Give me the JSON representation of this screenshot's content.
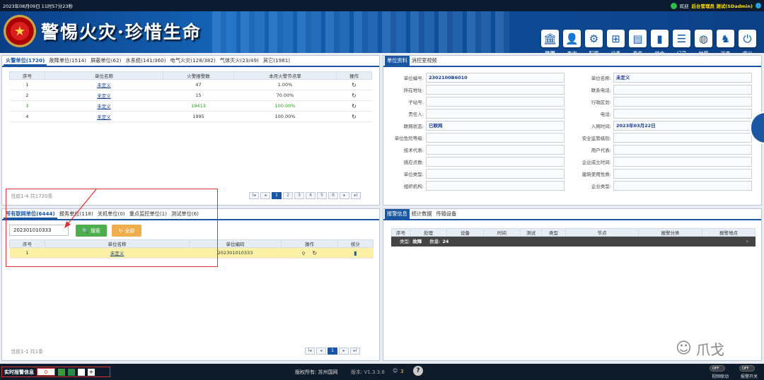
{
  "topbar": {
    "datetime": "2023年08月09日 11时57分23秒",
    "welcome": "欢迎",
    "user": "后台管理员 测试(SDadmin)"
  },
  "banner": {
    "slogan": "警惕火灾·珍惜生命"
  },
  "nav": [
    {
      "label": "监测",
      "icon": "monitor-icon",
      "glyph": "🏛"
    },
    {
      "label": "查询",
      "icon": "user-icon",
      "glyph": "👤"
    },
    {
      "label": "配置",
      "icon": "gear-icon",
      "glyph": "⚙"
    },
    {
      "label": "设备",
      "icon": "network-icon",
      "glyph": "⊞"
    },
    {
      "label": "事件",
      "icon": "document-icon",
      "glyph": "▤"
    },
    {
      "label": "综合",
      "icon": "bar-chart-icon",
      "glyph": "▮"
    },
    {
      "label": "记录",
      "icon": "list-icon",
      "glyph": "☰"
    },
    {
      "label": "地图",
      "icon": "globe-icon",
      "glyph": "◍"
    },
    {
      "label": "巡查",
      "icon": "patrol-icon",
      "glyph": "♞"
    },
    {
      "label": "退出",
      "icon": "power-icon",
      "glyph": "⏻"
    }
  ],
  "fire_panel": {
    "tabs": [
      "火警单位(1720)",
      "故障单位(1514)",
      "屏蔽单位(62)",
      "水系统(141/360)",
      "电气火灾(128/382)",
      "气体灭火(23/49)",
      "其它(1981)"
    ],
    "headers": [
      "序号",
      "单位名称",
      "火警报警数",
      "本月火警节点率",
      "操作"
    ],
    "rows": [
      {
        "no": "1",
        "name": "未定义",
        "count": "47",
        "rate": "1.00%"
      },
      {
        "no": "2",
        "name": "未定义",
        "count": "15",
        "rate": "70.00%"
      },
      {
        "no": "3",
        "name": "未定义",
        "count": "19413",
        "rate": "100.00%"
      },
      {
        "no": "4",
        "name": "未定义",
        "count": "1995",
        "rate": "100.00%"
      }
    ],
    "count_text": "当前1-4 共1720条",
    "pages": [
      "I◂",
      "◂",
      "1",
      "2",
      "3",
      "4",
      "5",
      "6",
      "▸",
      "▸I"
    ]
  },
  "network_panel": {
    "tabs": [
      "所有联网单位(6444)",
      "报务单位(118)",
      "关机单位(0)",
      "重点监控单位(1)",
      "测试单位(6)"
    ],
    "search_value": "202301010333",
    "search_label": "搜索",
    "all_label": "全部",
    "headers": [
      "序号",
      "单位名称",
      "单位编码",
      "操作",
      "统计"
    ],
    "rows": [
      {
        "no": "1",
        "name": "未定义",
        "code": "202301010333"
      }
    ],
    "count_text": "当前1-1 共1条",
    "pages": [
      "I◂",
      "◂",
      "1",
      "▸",
      "▸I"
    ]
  },
  "info_panel": {
    "tabs": [
      "单位资料",
      "消控室视频"
    ],
    "left_fields": [
      {
        "label": "单位编号:",
        "value": "2302100B6010"
      },
      {
        "label": "所在地址:",
        "value": ""
      },
      {
        "label": "子站号:",
        "value": ""
      },
      {
        "label": "责任人:",
        "value": ""
      },
      {
        "label": "联网状态:",
        "value": "已联网"
      },
      {
        "label": "单位危险等级:",
        "value": ""
      },
      {
        "label": "技术代表:",
        "value": ""
      },
      {
        "label": "感应点数:",
        "value": ""
      },
      {
        "label": "单位类型:",
        "value": ""
      },
      {
        "label": "组织机构:",
        "value": ""
      }
    ],
    "right_fields": [
      {
        "label": "单位名称:",
        "value": "未定义"
      },
      {
        "label": "联系电话:",
        "value": ""
      },
      {
        "label": "行政区划:",
        "value": ""
      },
      {
        "label": "电话:",
        "value": ""
      },
      {
        "label": "入网时间:",
        "value": "2023年03月22日"
      },
      {
        "label": "安全监管级别:",
        "value": ""
      },
      {
        "label": "用户代表:",
        "value": ""
      },
      {
        "label": "企业成立时间:",
        "value": ""
      },
      {
        "label": "建筑使用性质:",
        "value": ""
      },
      {
        "label": "企业类型:",
        "value": ""
      }
    ]
  },
  "alarm_panel": {
    "tabs": [
      "报警信息",
      "统计数据",
      "传输设备"
    ],
    "headers": [
      "序号",
      "处理",
      "设备",
      "时间",
      "测试",
      "类型",
      "节点",
      "报警分类",
      "报警地点"
    ],
    "group_type_label": "类型:",
    "group_type": "故障",
    "group_count_label": "数量:",
    "group_count": "24"
  },
  "footer": {
    "realtime_label": "实时报警信息",
    "realtime_count": "0",
    "copyright": "版权所有: 苏州国网",
    "version": "版本: V1.3.3.8",
    "online": "3",
    "video_link": "视频联动",
    "alarm_switch": "报警开关",
    "off": "OFF"
  },
  "watermark": "爪戈"
}
